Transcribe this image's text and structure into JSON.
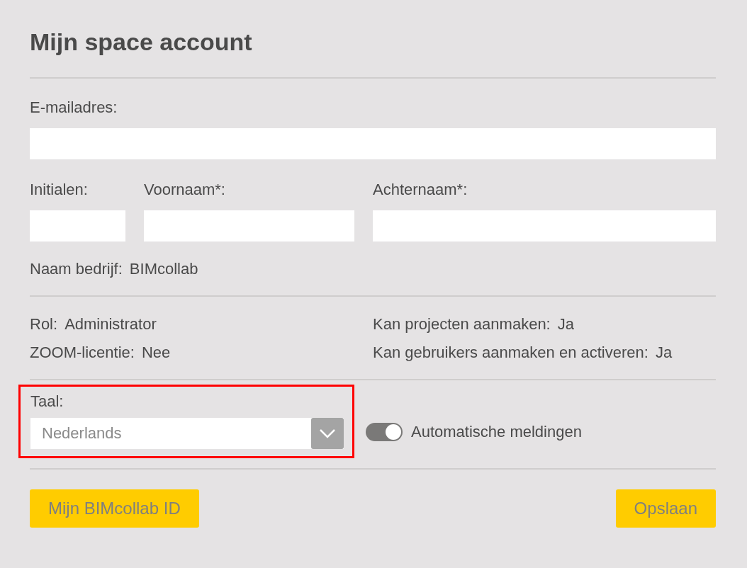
{
  "title": "Mijn space account",
  "email": {
    "label": "E-mailadres:"
  },
  "name_fields": [
    {
      "label": "Initialen:"
    },
    {
      "label": "Voornaam*:"
    },
    {
      "label": "Achternaam*:"
    }
  ],
  "company": {
    "label": "Naam bedrijf:",
    "value": "BIMcollab"
  },
  "info_left": [
    {
      "label": "Rol:",
      "value": "Administrator"
    },
    {
      "label": "ZOOM-licentie:",
      "value": "Nee"
    }
  ],
  "info_right": [
    {
      "label": "Kan projecten aanmaken:",
      "value": "Ja"
    },
    {
      "label": "Kan gebruikers aanmaken en activeren:",
      "value": "Ja"
    }
  ],
  "language": {
    "label": "Taal:",
    "value": "Nederlands",
    "highlighted": true
  },
  "notifications": {
    "label": "Automatische meldingen",
    "on": true
  },
  "buttons": [
    {
      "label": "Mijn BIMcollab ID"
    },
    {
      "label": "Opslaan"
    }
  ]
}
